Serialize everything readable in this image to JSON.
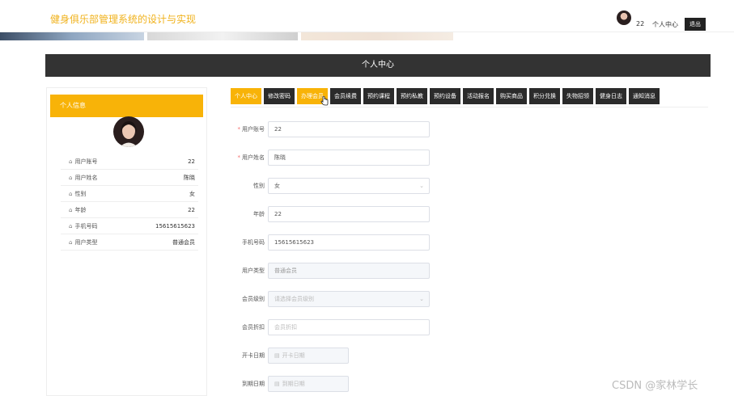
{
  "header": {
    "site_title": "健身俱乐部管理系统的设计与实现",
    "user_num": "22",
    "user_center": "个人中心",
    "logout": "退出"
  },
  "page_title": "个人中心",
  "profile": {
    "title": "个人信息",
    "rows": [
      {
        "label": "用户账号",
        "value": "22"
      },
      {
        "label": "用户姓名",
        "value": "陈晓"
      },
      {
        "label": "性别",
        "value": "女"
      },
      {
        "label": "年龄",
        "value": "22"
      },
      {
        "label": "手机号码",
        "value": "15615615623"
      },
      {
        "label": "用户类型",
        "value": "普通会员"
      }
    ]
  },
  "tabs": [
    "个人中心",
    "修改密码",
    "办理会员",
    "会员续费",
    "预约课程",
    "预约私教",
    "预约设备",
    "活动报名",
    "购买商品",
    "积分兑换",
    "失物招领",
    "健身日志",
    "通知消息"
  ],
  "form": {
    "account_label": "用户账号",
    "account_value": "22",
    "name_label": "用户姓名",
    "name_value": "陈晓",
    "gender_label": "性别",
    "gender_value": "女",
    "age_label": "年龄",
    "age_value": "22",
    "phone_label": "手机号码",
    "phone_value": "15615615623",
    "usertype_label": "用户类型",
    "usertype_value": "普通会员",
    "level_label": "会员级别",
    "level_placeholder": "请选择会员级别",
    "discount_label": "会员折扣",
    "discount_placeholder": "会员折扣",
    "start_label": "开卡日期",
    "start_placeholder": "开卡日期",
    "end_label": "到期日期",
    "end_placeholder": "到期日期"
  },
  "watermark": "CSDN @家林学长",
  "colors": {
    "accent": "#f8b308",
    "dark": "#333333"
  }
}
